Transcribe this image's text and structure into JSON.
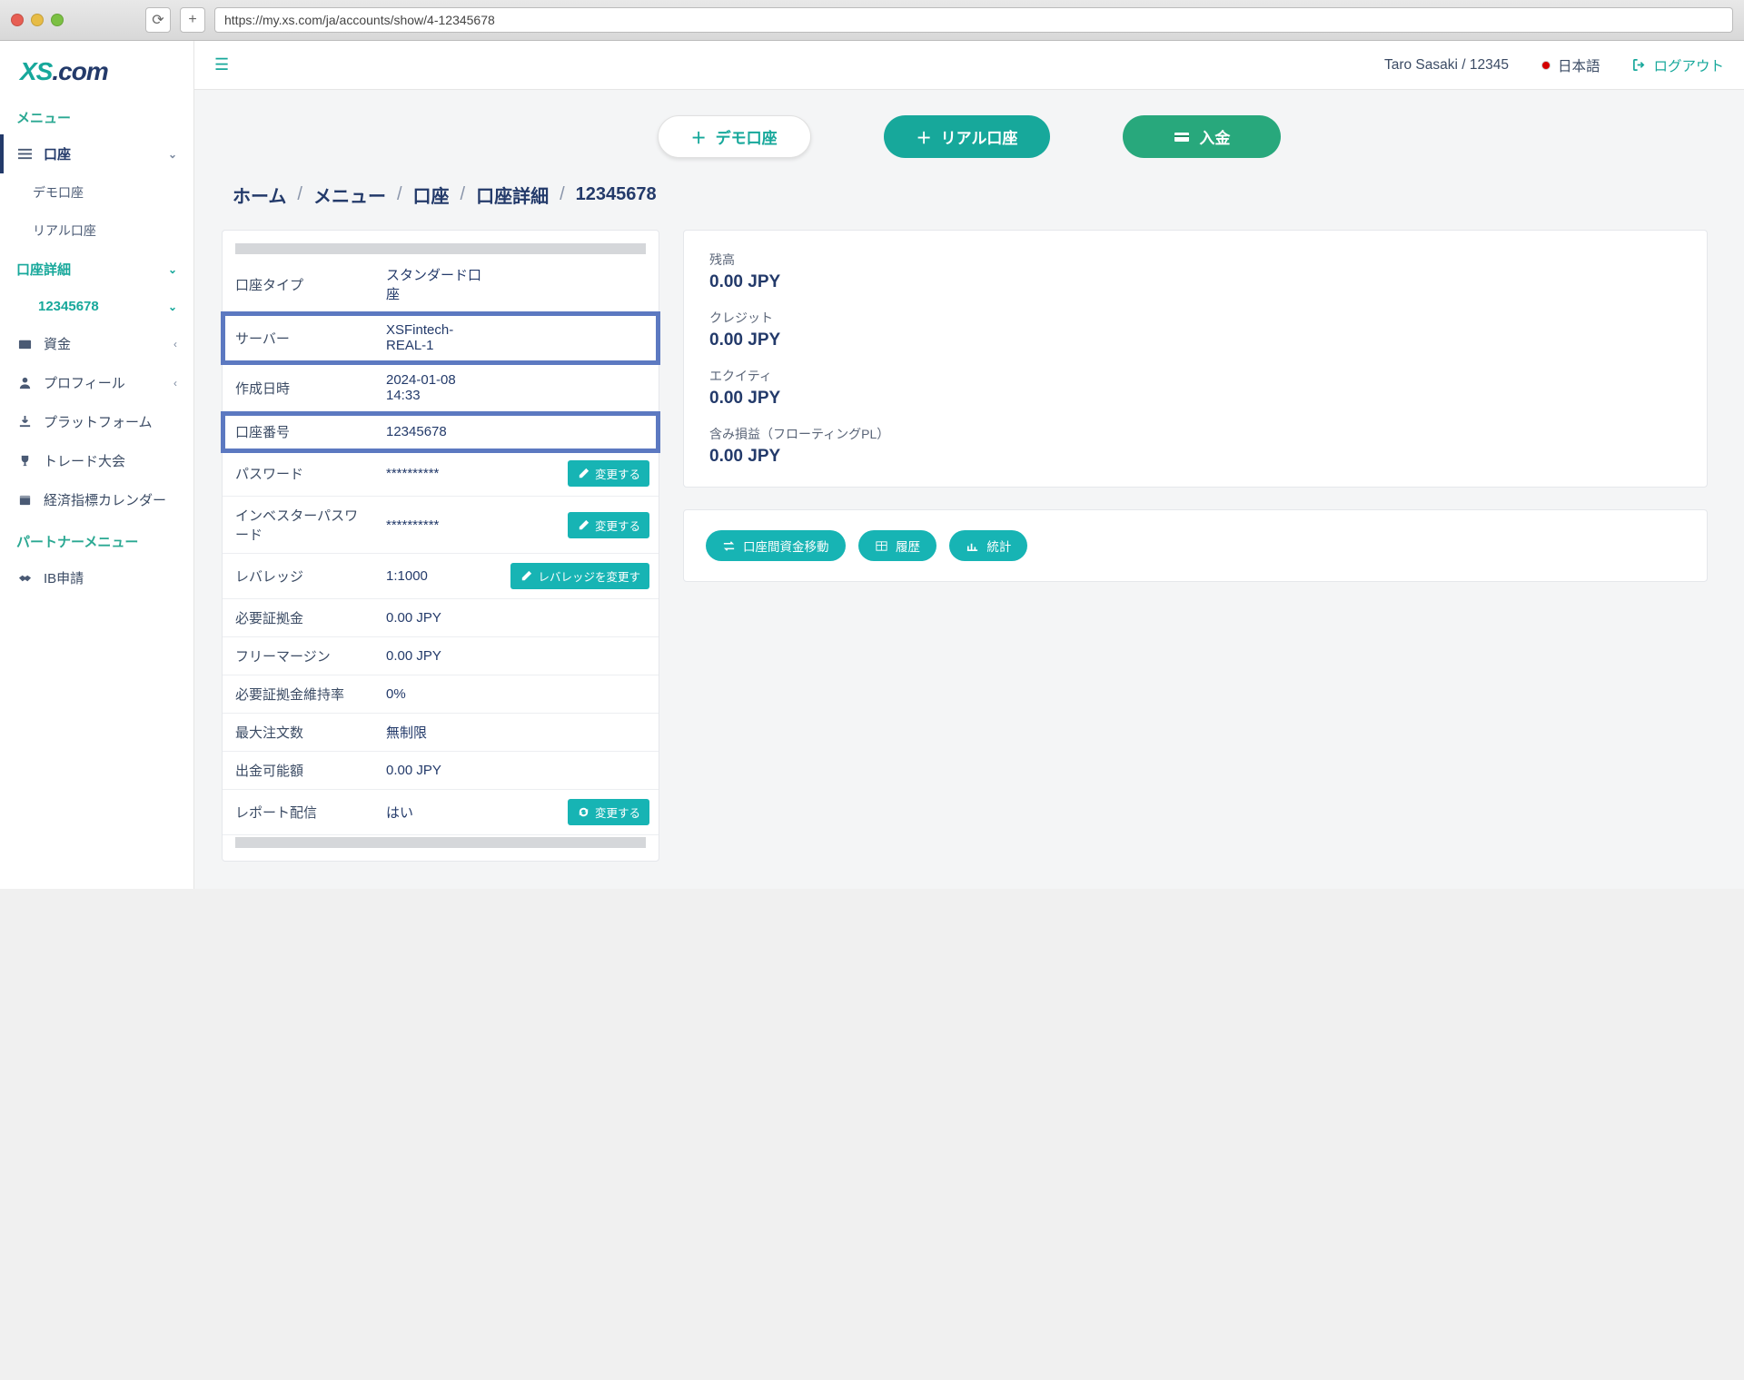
{
  "url": "https://my.xs.com/ja/accounts/show/4-12345678",
  "logo": {
    "xs": "XS",
    "com": ".com"
  },
  "sidebar": {
    "menu_header": "メニュー",
    "accounts": "口座",
    "demo": "デモ口座",
    "real": "リアル口座",
    "detail": "口座詳細",
    "acct_num": "12345678",
    "funds": "資金",
    "profile": "プロフィール",
    "platform": "プラットフォーム",
    "contest": "トレード大会",
    "calendar": "経済指標カレンダー",
    "partner_header": "パートナーメニュー",
    "ib": "IB申請"
  },
  "topbar": {
    "user": "Taro Sasaki / 12345",
    "lang": "日本語",
    "logout": "ログアウト"
  },
  "actions": {
    "demo": "デモ口座",
    "real": "リアル口座",
    "deposit": "入金"
  },
  "breadcrumb": {
    "home": "ホーム",
    "menu": "メニュー",
    "acct": "口座",
    "detail": "口座詳細",
    "num": "12345678"
  },
  "details": {
    "type_l": "口座タイプ",
    "type_v": "スタンダード口座",
    "server_l": "サーバー",
    "server_v": "XSFintech-REAL-1",
    "created_l": "作成日時",
    "created_v": "2024-01-08 14:33",
    "acctnum_l": "口座番号",
    "acctnum_v": "12345678",
    "pwd_l": "パスワード",
    "pwd_v": "**********",
    "invpwd_l": "インベスターパスワード",
    "invpwd_v": "**********",
    "lev_l": "レバレッジ",
    "lev_v": "1:1000",
    "margin_l": "必要証拠金",
    "margin_v": "0.00 JPY",
    "freemargin_l": "フリーマージン",
    "freemargin_v": "0.00 JPY",
    "mlevel_l": "必要証拠金維持率",
    "mlevel_v": "0%",
    "maxorders_l": "最大注文数",
    "maxorders_v": "無制限",
    "withdraw_l": "出金可能額",
    "withdraw_v": "0.00 JPY",
    "report_l": "レポート配信",
    "report_v": "はい",
    "btn_change": "変更する",
    "btn_lev": "レバレッジを変更す"
  },
  "balance": {
    "bal_l": "残高",
    "bal_v": "0.00 JPY",
    "credit_l": "クレジット",
    "credit_v": "0.00 JPY",
    "equity_l": "エクイティ",
    "equity_v": "0.00 JPY",
    "float_l": "含み損益（フローティングPL）",
    "float_v": "0.00 JPY"
  },
  "ops": {
    "transfer": "口座間資金移動",
    "history": "履歴",
    "stats": "統計"
  }
}
